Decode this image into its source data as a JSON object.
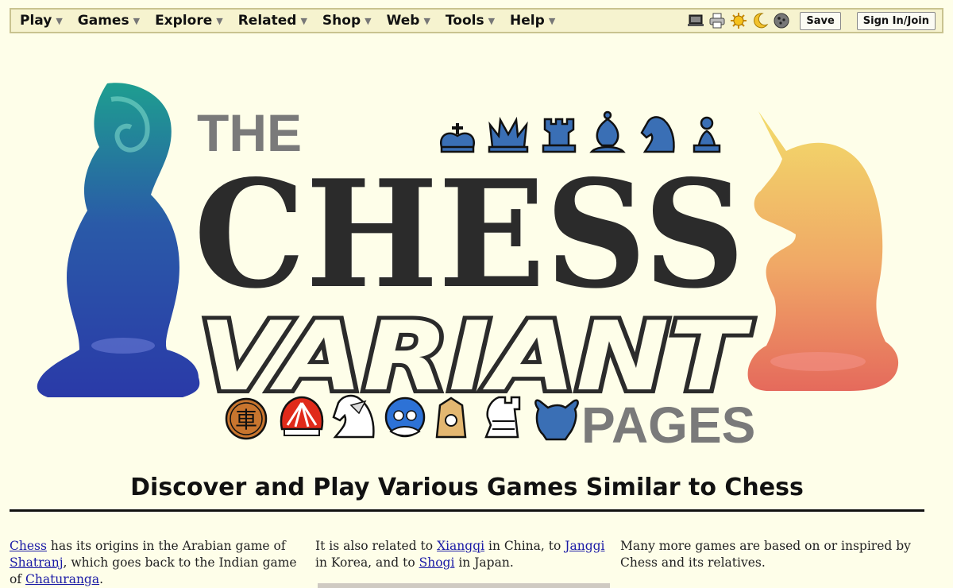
{
  "menu": {
    "items": [
      {
        "label": "Play"
      },
      {
        "label": "Games"
      },
      {
        "label": "Explore"
      },
      {
        "label": "Related"
      },
      {
        "label": "Shop"
      },
      {
        "label": "Web"
      },
      {
        "label": "Tools"
      },
      {
        "label": "Help"
      }
    ],
    "tools": [
      "laptop-icon",
      "printer-icon",
      "sun-icon",
      "moon-icon",
      "cookie-icon"
    ],
    "save_label": "Save",
    "signin_label": "Sign In/Join"
  },
  "banner": {
    "the": "THE",
    "chess": "CHESS",
    "variant": "VARIANT",
    "pages": "PAGES"
  },
  "tagline": "Discover and Play Various Games Similar to Chess",
  "columns": [
    {
      "link1": "Chess",
      "text1": " has its origins in the Arabian game of ",
      "link2": "Shatranj",
      "text2": ", which goes back to the Indian game of ",
      "link3": "Chaturanga",
      "text3": "."
    },
    {
      "text0": "It is also related to ",
      "link1": "Xiangqi",
      "text1": " in China, to ",
      "link2": "Janggi",
      "text2": " in Korea, and to ",
      "link3": "Shogi",
      "text3": " in Japan."
    },
    {
      "text0": "Many more games are based on or inspired by Chess and its relatives."
    }
  ],
  "colors": {
    "background": "#fefee9",
    "menubar": "#f6f3cf",
    "link": "#1a1aa6",
    "piece_blue": "#3a6fb5",
    "logo_dark": "#2b2b2b",
    "logo_gray": "#7a7a7a"
  }
}
